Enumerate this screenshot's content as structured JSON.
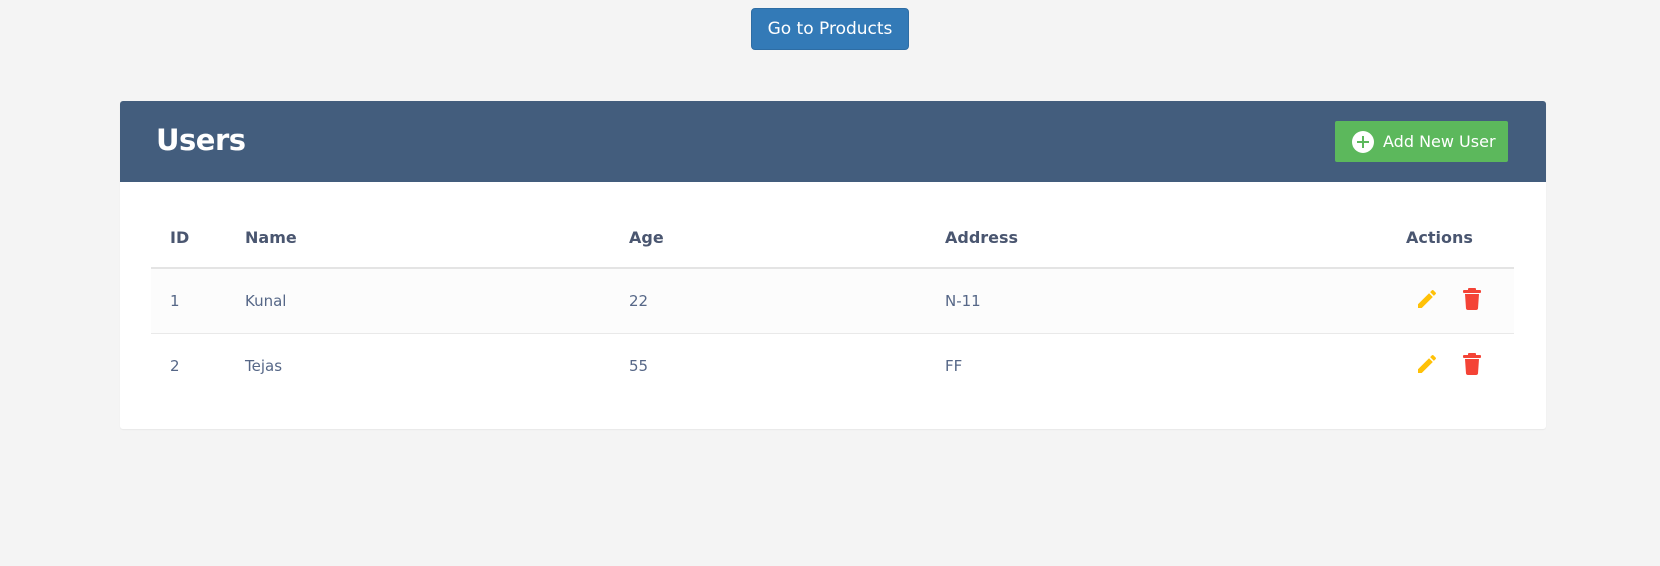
{
  "nav": {
    "products_label": "Go to Products"
  },
  "panel": {
    "title": "Users",
    "add_label": "Add New User"
  },
  "table": {
    "headers": {
      "id": "ID",
      "name": "Name",
      "age": "Age",
      "address": "Address",
      "actions": "Actions"
    },
    "rows": [
      {
        "id": "1",
        "name": "Kunal",
        "age": "22",
        "address": "N-11"
      },
      {
        "id": "2",
        "name": "Tejas",
        "age": "55",
        "address": "FF"
      }
    ]
  },
  "icons": {
    "add": "plus-circle-icon",
    "edit": "pencil-icon",
    "delete": "trash-icon"
  },
  "colors": {
    "header_bg": "#435d7d",
    "nav_button": "#337ab7",
    "add_button": "#5cb85c",
    "edit_icon": "#ffc107",
    "delete_icon": "#f44336"
  }
}
